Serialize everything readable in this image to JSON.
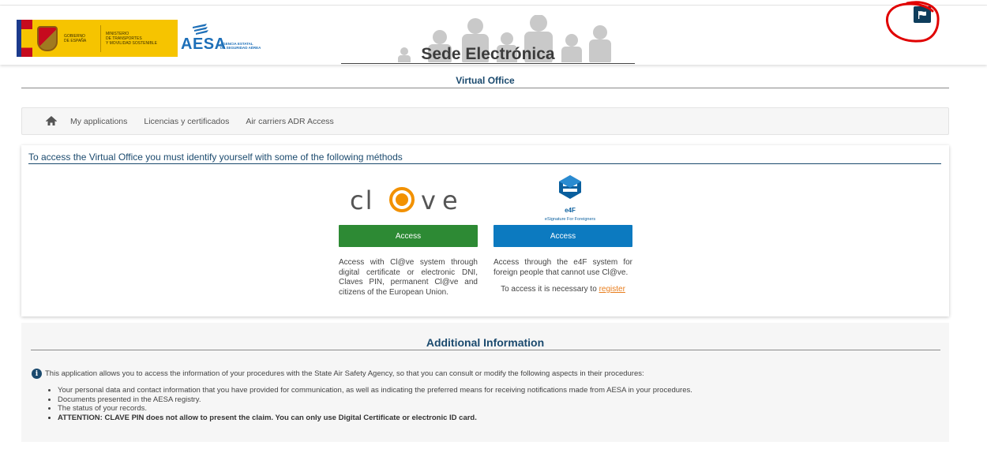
{
  "header": {
    "gov_text": [
      "GOBIERNO",
      "DE ESPAÑA"
    ],
    "ministry_text": [
      "MINISTERIO",
      "DE TRANSPORTES",
      "Y MOVILIDAD SOSTENIBLE"
    ],
    "aesa_word": "AESA",
    "aesa_sub": [
      "AGENCIA ESTATAL",
      "DE SEGURIDAD AÉREA"
    ],
    "sede_title": "Sede Electrónica",
    "language_flag_icon": "flag-icon",
    "annotation_color": "#e00000"
  },
  "page": {
    "title": "Virtual Office"
  },
  "breadcrumb": {
    "home_icon": "home-icon",
    "items": [
      "My applications",
      "Licencias y certificados",
      "Air carriers ADR Access"
    ]
  },
  "access": {
    "title": "To access the Virtual Office you must identify yourself with some of the following méthods",
    "clave": {
      "logo_text": "cl@ve",
      "button_label": "Access",
      "button_color": "#2d8a34",
      "description": "Access with Cl@ve system through digital certificate or electronic DNI, Claves PIN, permanent Cl@ve and citizens of the European Union."
    },
    "e4f": {
      "logo_text": "e4F",
      "logo_subtitle": "eSignature For Foreigners",
      "button_label": "Access",
      "button_color": "#0c7ac0",
      "description": "Access through the e4F system for foreign people that cannot use Cl@ve.",
      "register_prefix": "To access it is necessary to ",
      "register_link": "register"
    }
  },
  "additional": {
    "title": "Additional Information",
    "intro": "This application allows you to access the information of your procedures with the State Air Safety Agency, so that you can consult or modify the following aspects in their procedures:",
    "items": [
      "Your personal data and contact information that you have provided for communication, as well as indicating the preferred means for receiving notifications made from AESA in your procedures.",
      "Documents presented in the AESA registry.",
      "The status of your records.",
      "ATTENTION: CLAVE PIN does not allow to present the claim. You can only use Digital Certificate or electronic ID card."
    ]
  }
}
